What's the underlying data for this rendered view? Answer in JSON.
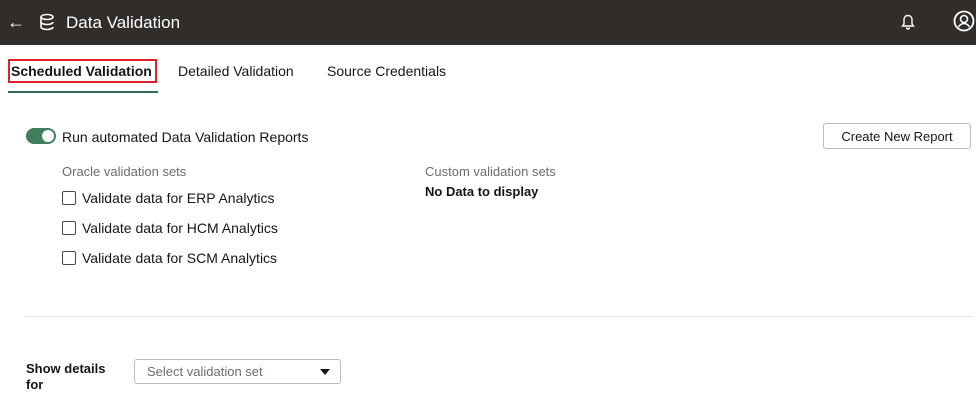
{
  "header": {
    "back_glyph": "←",
    "title": "Data Validation",
    "icons": [
      "arrow-left-icon",
      "database-icon",
      "bell-icon",
      "user-avatar-icon"
    ],
    "background_color": "#312d2a"
  },
  "tabs": [
    {
      "label": "Scheduled Validation",
      "active": true
    },
    {
      "label": "Detailed Validation",
      "active": false
    },
    {
      "label": "Source Credentials",
      "active": false
    }
  ],
  "automation": {
    "toggle_on": true,
    "toggle_label": "Run automated Data Validation Reports",
    "toggle_color": "#3f7f5b"
  },
  "create_button_label": "Create New Report",
  "oracle_sets": {
    "heading": "Oracle validation sets",
    "items": [
      {
        "label": "Validate data for ERP Analytics",
        "checked": false
      },
      {
        "label": "Validate data for HCM Analytics",
        "checked": false
      },
      {
        "label": "Validate data for SCM Analytics",
        "checked": false
      }
    ]
  },
  "custom_sets": {
    "heading": "Custom validation sets",
    "empty_text": "No Data to display"
  },
  "details": {
    "label": "Show details for",
    "select_placeholder": "Select validation set"
  },
  "colors": {
    "active_tab_underline": "#2f6b4f",
    "active_tab_highlight_border": "#e0202a"
  }
}
